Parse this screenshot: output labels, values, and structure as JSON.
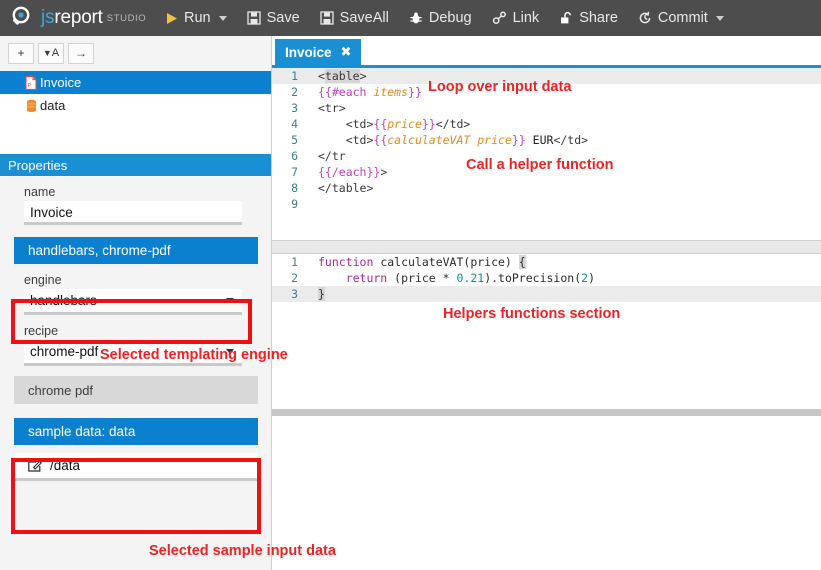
{
  "app": {
    "brand_js": "js",
    "brand_report": "report",
    "brand_studio": "STUDIO",
    "accent_blue": "#1b8fd3",
    "accent_blue_dark": "#0b80cf",
    "topbar_bg": "#4d4d4d",
    "annotation_red": "#ee2222"
  },
  "toolbar": {
    "run": "Run",
    "save": "Save",
    "saveall": "SaveAll",
    "debug": "Debug",
    "link": "Link",
    "share": "Share",
    "commit": "Commit",
    "icons": {
      "run": "play-icon",
      "save": "floppy-icon",
      "saveall": "floppy-icon",
      "debug": "bug-icon",
      "link": "link-icon",
      "share": "unlock-icon",
      "commit": "history-icon"
    }
  },
  "sidebar": {
    "buttons": [
      {
        "name": "add-button",
        "glyph": "+"
      },
      {
        "name": "sort-button",
        "glyph": "▼A"
      },
      {
        "name": "arrow-button",
        "glyph": "→"
      }
    ],
    "tree": [
      {
        "label": "Invoice",
        "icon": "pdf-file-icon",
        "selected": true
      },
      {
        "label": "data",
        "icon": "database-icon",
        "selected": false
      }
    ]
  },
  "properties": {
    "header": "Properties",
    "name_label": "name",
    "name_value": "Invoice",
    "section_engine_recipe": "handlebars, chrome-pdf",
    "engine_label": "engine",
    "engine_value": "handlebars",
    "recipe_label": "recipe",
    "recipe_value": "chrome-pdf",
    "section_chrome_pdf": "chrome pdf",
    "section_sample_data": "sample data: data",
    "sample_data_path": "/data",
    "sample_data_icon": "edit-pencil-icon"
  },
  "tabs": [
    {
      "label": "Invoice",
      "close": "✖",
      "active": true
    }
  ],
  "editors": {
    "template": {
      "lines": [
        {
          "n": "1",
          "highlight": true,
          "tokens": [
            {
              "t": "<",
              "c": "tok-tag"
            },
            {
              "t": "table",
              "c": "tok-tag tok-brk"
            },
            {
              "t": ">",
              "c": "tok-tag"
            }
          ]
        },
        {
          "n": "2",
          "highlight": false,
          "tokens": [
            {
              "t": "{{#each ",
              "c": "tok-hb"
            },
            {
              "t": "items",
              "c": "tok-id"
            },
            {
              "t": "}}",
              "c": "tok-hb"
            }
          ]
        },
        {
          "n": "3",
          "highlight": false,
          "tokens": [
            {
              "t": "<tr>",
              "c": "tok-tag"
            }
          ]
        },
        {
          "n": "4",
          "highlight": false,
          "tokens": [
            {
              "t": "    <td>",
              "c": "tok-tag"
            },
            {
              "t": "{{",
              "c": "tok-hb"
            },
            {
              "t": "price",
              "c": "tok-id"
            },
            {
              "t": "}}",
              "c": "tok-hb"
            },
            {
              "t": "</td>",
              "c": "tok-tag"
            }
          ]
        },
        {
          "n": "5",
          "highlight": false,
          "tokens": [
            {
              "t": "    <td>",
              "c": "tok-tag"
            },
            {
              "t": "{{",
              "c": "tok-hb"
            },
            {
              "t": "calculateVAT price",
              "c": "tok-id"
            },
            {
              "t": "}}",
              "c": "tok-hb"
            },
            {
              "t": " EUR",
              "c": "tok-plain"
            },
            {
              "t": "</td>",
              "c": "tok-tag"
            }
          ]
        },
        {
          "n": "6",
          "highlight": false,
          "tokens": [
            {
              "t": "</tr",
              "c": "tok-tag"
            }
          ]
        },
        {
          "n": "7",
          "highlight": false,
          "tokens": [
            {
              "t": "{{/each}}",
              "c": "tok-hb"
            },
            {
              "t": ">",
              "c": "tok-tag"
            }
          ]
        },
        {
          "n": "8",
          "highlight": false,
          "tokens": [
            {
              "t": "</table>",
              "c": "tok-tag"
            }
          ]
        },
        {
          "n": "9",
          "highlight": false,
          "tokens": [
            {
              "t": "",
              "c": "tok-plain"
            }
          ]
        }
      ]
    },
    "helpers": {
      "lines": [
        {
          "n": "1",
          "highlight": false,
          "tokens": [
            {
              "t": "function ",
              "c": "tok-kw"
            },
            {
              "t": "calculateVAT(price) ",
              "c": "tok-fn"
            },
            {
              "t": "{",
              "c": "tok-fn tok-brk"
            }
          ]
        },
        {
          "n": "2",
          "highlight": false,
          "tokens": [
            {
              "t": "    return ",
              "c": "tok-kw"
            },
            {
              "t": "(price * ",
              "c": "tok-fn"
            },
            {
              "t": "0.21",
              "c": "tok-num"
            },
            {
              "t": ").toPrecision(",
              "c": "tok-fn"
            },
            {
              "t": "2",
              "c": "tok-num"
            },
            {
              "t": ")",
              "c": "tok-fn"
            }
          ]
        },
        {
          "n": "3",
          "highlight": true,
          "tokens": [
            {
              "t": "}",
              "c": "tok-fn tok-brk"
            }
          ]
        }
      ]
    }
  },
  "annotations": [
    {
      "text": "Loop over input data",
      "name": "annotation-loop"
    },
    {
      "text": "Call a helper function",
      "name": "annotation-helper-call"
    },
    {
      "text": "Helpers functions section",
      "name": "annotation-helpers-section"
    },
    {
      "text": "Selected templating engine",
      "name": "annotation-engine"
    },
    {
      "text": "Selected sample input data",
      "name": "annotation-sample-data"
    }
  ]
}
